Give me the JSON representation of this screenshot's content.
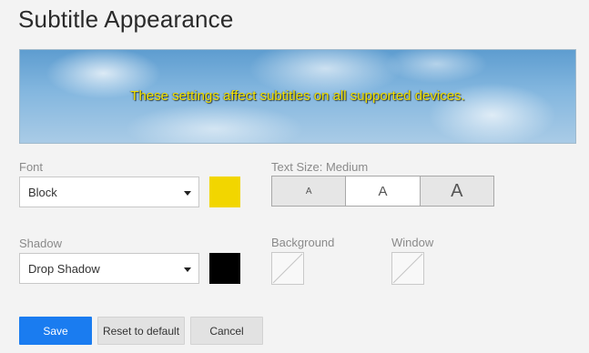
{
  "page_title": "Subtitle Appearance",
  "preview": {
    "text": "These settings affect subtitles on all supported devices."
  },
  "font": {
    "label": "Font",
    "selected": "Block",
    "color": "#f2d600",
    "color_icon": "color-swatch-icon",
    "dropdown_icon": "caret-down-icon"
  },
  "shadow": {
    "label": "Shadow",
    "selected": "Drop Shadow",
    "color": "#000000",
    "color_icon": "color-swatch-icon",
    "dropdown_icon": "caret-down-icon"
  },
  "text_size": {
    "label": "Text Size: Medium",
    "options": [
      {
        "label": "A",
        "selected": false
      },
      {
        "label": "A",
        "selected": true
      },
      {
        "label": "A",
        "selected": false
      }
    ]
  },
  "background": {
    "label": "Background",
    "value_icon": "no-color-icon"
  },
  "window": {
    "label": "Window",
    "value_icon": "no-color-icon"
  },
  "buttons": {
    "save": "Save",
    "reset": "Reset to default",
    "cancel": "Cancel"
  },
  "colors": {
    "accent": "#1a7cf0",
    "preview_text": "#f2e000"
  }
}
